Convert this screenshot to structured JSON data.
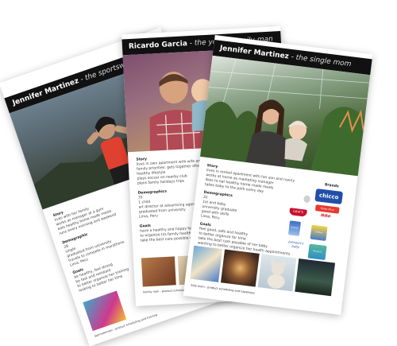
{
  "cards": [
    {
      "name": "Jennifer Martinez",
      "role": "the sportswoman",
      "story_heading": "Story",
      "story_lines": [
        "lives with her family",
        "works as manager at a gym",
        "eats healthy home made meals",
        "runs every morning and weekend"
      ],
      "demographics_heading": "Demographic",
      "demographic_lines": [
        "28",
        "single",
        "graduated from university",
        "travels to compete in marathons",
        "Lima, Peru"
      ],
      "goals_heading": "Goals",
      "goal_lines": [
        "be healthy, feel strong",
        "be fast and resistant",
        "to better organize her training",
        "looking to better her time"
      ],
      "footer": "Sportswoman - product scheduling and training"
    },
    {
      "name": "Ricardo Garcia",
      "role": "the young family man",
      "story_heading": "Story",
      "story_lines": [
        "lives in own apartment with wife and child",
        "family priorities: gets together often",
        "healthy lifestyle",
        "plays soccer on nearby club",
        "plans family holidays trips"
      ],
      "demographics_heading": "Demographics",
      "demographic_lines": [
        "35",
        "1 child",
        "art director at advertising agency",
        "graduated from university",
        "Lima, Peru"
      ],
      "goals_heading": "Goals",
      "goal_lines": [
        "have a healthy and happy family",
        "to organize his family health as a priority",
        "take the best care possible of his family"
      ],
      "footer": "Family man - product scheduling and happiness"
    },
    {
      "name": "Jennifer Martinez",
      "role": "the single mom",
      "story_heading": "Story",
      "story_lines": [
        "lives in rented apartment with her son and nanny",
        "works at home as marketing manager",
        "likes to eat healthy home made meals",
        "takes baby to the park every day"
      ],
      "demographics_heading": "Demographics",
      "demographic_lines": [
        "32",
        "1st and baby",
        "university graduate",
        "good with skills",
        "Lima, Peru"
      ],
      "goals_heading": "Goals",
      "goal_lines": [
        "feel good, safe and healthy",
        "to better organize for time",
        "take the best care possible of her baby",
        "wanting to better organize her health appointments"
      ],
      "brands_heading": "Brands",
      "brands": [
        "chicco",
        "Apple",
        "Fisher-Price",
        "Levi's",
        "Nike",
        "Enfamil",
        "Similac",
        "Johnson's baby",
        "Pampers"
      ],
      "footer": "Sole mom - product scheduling and happiness"
    }
  ],
  "colors": {
    "bar": "#111111",
    "chicco": "#1f4fa8",
    "levis": "#c8102e",
    "nike": "#d01020"
  }
}
